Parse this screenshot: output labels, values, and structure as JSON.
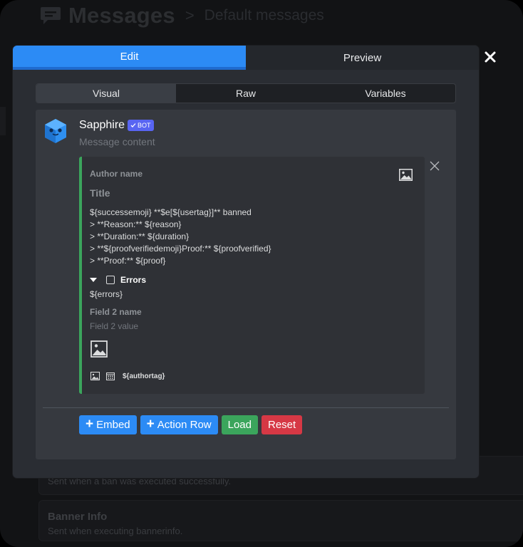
{
  "background": {
    "page_title": "Messages",
    "breadcrumb_sep": ">",
    "page_subtitle": "Default messages",
    "cards": [
      {
        "title": "",
        "desc": "Sent when a ban was executed successfully."
      },
      {
        "title": "Banner Info",
        "desc": "Sent when executing bannerinfo."
      }
    ]
  },
  "modal": {
    "tabs": [
      {
        "label": "Edit"
      },
      {
        "label": "Preview"
      }
    ],
    "close_label": "×",
    "subtabs": [
      {
        "label": "Visual"
      },
      {
        "label": "Raw"
      },
      {
        "label": "Variables"
      }
    ],
    "bot": {
      "name": "Sapphire",
      "badge": "BOT",
      "message_placeholder": "Message content"
    },
    "embed": {
      "accent": "#3ba55c",
      "author_placeholder": "Author name",
      "title_placeholder": "Title",
      "description": "${successemoji} **$e[${usertag}]** banned\n> **Reason:** ${reason}\n> **Duration:** ${duration}\n> **${proofverifiedemoji}Proof:** ${proofverified}\n> **Proof:** ${proof}",
      "field1": {
        "name": "Errors",
        "value": "${errors}"
      },
      "field2": {
        "name": "Field 2 name",
        "value": "Field 2 value"
      },
      "footer_text": "${authortag}"
    },
    "buttons": {
      "embed": "Embed",
      "action_row": "Action Row",
      "load": "Load",
      "reset": "Reset"
    }
  },
  "colors": {
    "primary": "#2c8bf5",
    "success": "#3ba55c",
    "danger": "#d63845",
    "blurple": "#5865f2"
  }
}
